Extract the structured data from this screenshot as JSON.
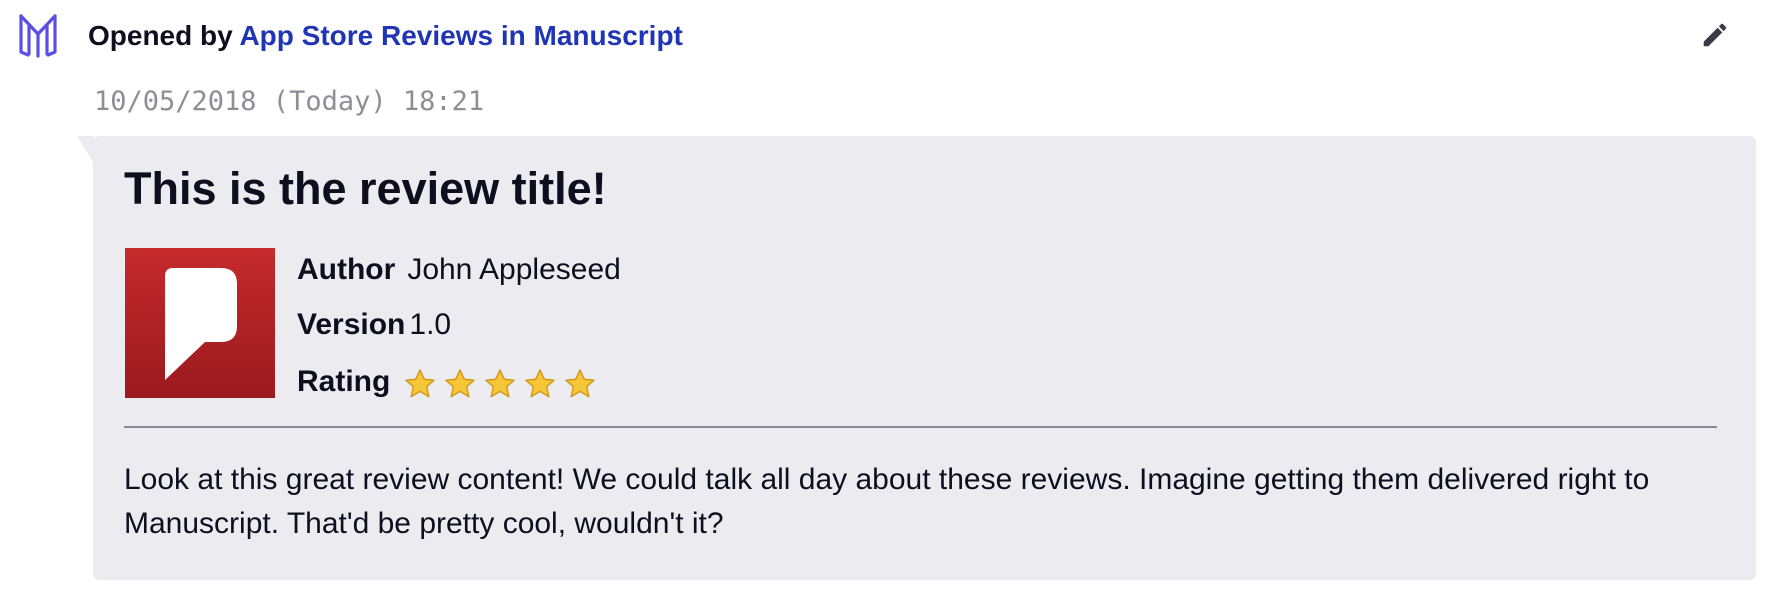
{
  "header": {
    "opened_label": "Opened by",
    "opener_name": "App Store Reviews in Manuscript",
    "logo_icon": "manuscript-logo-icon",
    "edit_icon": "pencil-icon",
    "brand_color": "#5a4fe0",
    "link_color": "#1f35b5"
  },
  "event": {
    "timestamp": "10/05/2018 (Today) 18:21"
  },
  "review": {
    "title": "This is the review title!",
    "app_icon": "speech-bubble-app-icon",
    "app_icon_color": "#b8202a",
    "author_label": "Author",
    "author": "John Appleseed",
    "version_label": "Version",
    "version": "1.0",
    "rating_label": "Rating",
    "rating": 5,
    "rating_max": 5,
    "body": "Look at this great review content! We could talk all day about these reviews. Imagine getting them delivered right to Manuscript. That'd be pretty cool, wouldn't it?"
  }
}
